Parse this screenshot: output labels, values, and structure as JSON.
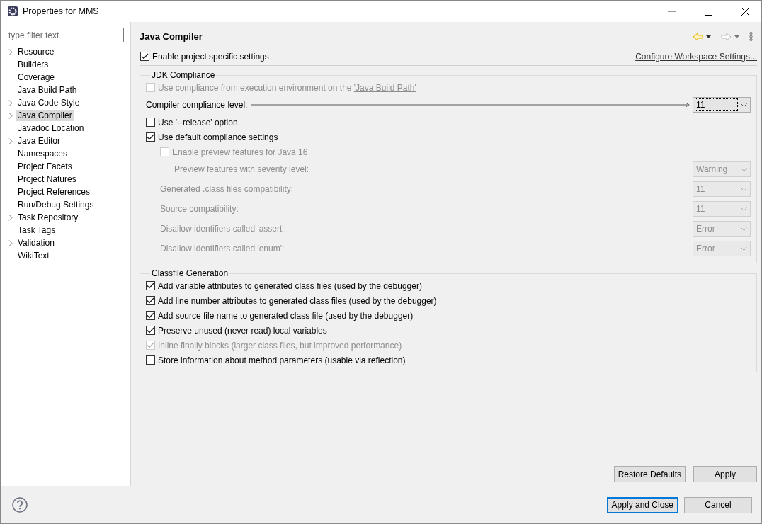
{
  "window": {
    "title": "Properties for MMS"
  },
  "filter": {
    "placeholder": "type filter text"
  },
  "tree": [
    {
      "label": "Resource",
      "expandable": true,
      "selected": false
    },
    {
      "label": "Builders",
      "expandable": false,
      "selected": false
    },
    {
      "label": "Coverage",
      "expandable": false,
      "selected": false
    },
    {
      "label": "Java Build Path",
      "expandable": false,
      "selected": false
    },
    {
      "label": "Java Code Style",
      "expandable": true,
      "selected": false
    },
    {
      "label": "Java Compiler",
      "expandable": true,
      "selected": true
    },
    {
      "label": "Javadoc Location",
      "expandable": false,
      "selected": false
    },
    {
      "label": "Java Editor",
      "expandable": true,
      "selected": false
    },
    {
      "label": "Namespaces",
      "expandable": false,
      "selected": false
    },
    {
      "label": "Project Facets",
      "expandable": false,
      "selected": false
    },
    {
      "label": "Project Natures",
      "expandable": false,
      "selected": false
    },
    {
      "label": "Project References",
      "expandable": false,
      "selected": false
    },
    {
      "label": "Run/Debug Settings",
      "expandable": false,
      "selected": false
    },
    {
      "label": "Task Repository",
      "expandable": true,
      "selected": false
    },
    {
      "label": "Task Tags",
      "expandable": false,
      "selected": false
    },
    {
      "label": "Validation",
      "expandable": true,
      "selected": false
    },
    {
      "label": "WikiText",
      "expandable": false,
      "selected": false
    }
  ],
  "page": {
    "title": "Java Compiler",
    "back_enabled": true,
    "forward_enabled": false,
    "enable": {
      "label": "Enable project specific settings",
      "checked": true
    },
    "workspace_link": "Configure Workspace Settings..."
  },
  "jdk": {
    "title": "JDK Compliance",
    "items": [
      {
        "kind": "checkbox",
        "label": "Use compliance from execution environment on the ",
        "link": "'Java Build Path'",
        "checked": false,
        "disabled": true
      },
      {
        "kind": "level",
        "label": "Compiler compliance level:",
        "value": "11",
        "disabled": false
      },
      {
        "kind": "checkbox",
        "label": "Use '--release' option",
        "checked": false,
        "disabled": false
      },
      {
        "kind": "checkbox",
        "label": "Use default compliance settings",
        "checked": true,
        "disabled": false,
        "children": [
          {
            "kind": "checkbox",
            "label": "Enable preview features for Java 16",
            "checked": false,
            "disabled": true,
            "children": [
              {
                "kind": "combo",
                "label": "Preview features with severity level:",
                "value": "Warning",
                "disabled": true
              }
            ]
          },
          {
            "kind": "combo",
            "label": "Generated .class files compatibility:",
            "value": "11",
            "disabled": true
          },
          {
            "kind": "combo",
            "label": "Source compatibility:",
            "value": "11",
            "disabled": true
          },
          {
            "kind": "combo",
            "label": "Disallow identifiers called 'assert':",
            "value": "Error",
            "disabled": true
          },
          {
            "kind": "combo",
            "label": "Disallow identifiers called 'enum':",
            "value": "Error",
            "disabled": true
          }
        ]
      }
    ]
  },
  "classfile": {
    "title": "Classfile Generation",
    "items": [
      {
        "kind": "checkbox",
        "label": "Add variable attributes to generated class files (used by the debugger)",
        "checked": true,
        "disabled": false
      },
      {
        "kind": "checkbox",
        "label": "Add line number attributes to generated class files (used by the debugger)",
        "checked": true,
        "disabled": false
      },
      {
        "kind": "checkbox",
        "label": "Add source file name to generated class file (used by the debugger)",
        "checked": true,
        "disabled": false
      },
      {
        "kind": "checkbox",
        "label": "Preserve unused (never read) local variables",
        "checked": true,
        "disabled": false
      },
      {
        "kind": "checkbox",
        "label": "Inline finally blocks (larger class files, but improved performance)",
        "checked": true,
        "disabled": true
      },
      {
        "kind": "checkbox",
        "label": "Store information about method parameters (usable via reflection)",
        "checked": false,
        "disabled": false
      }
    ]
  },
  "page_buttons": [
    {
      "label": "Restore Defaults"
    },
    {
      "label": "Apply"
    }
  ],
  "dialog_buttons": [
    {
      "label": "Apply and Close",
      "default": true
    },
    {
      "label": "Cancel",
      "default": false
    }
  ]
}
